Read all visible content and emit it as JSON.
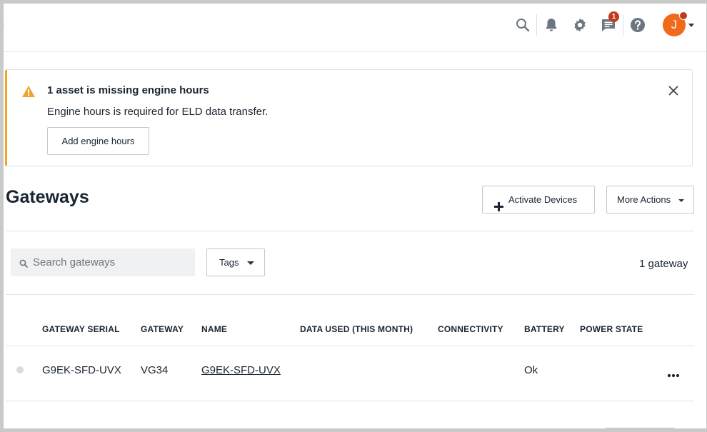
{
  "topbar": {
    "crumb_fragment": "t",
    "notifications_badge": "1",
    "avatar_initial": "J",
    "icons": [
      "search-icon",
      "bell-icon",
      "gear-icon",
      "chat-icon",
      "help-icon"
    ]
  },
  "alert": {
    "title": "1 asset is missing engine hours",
    "body": "Engine hours is required for ELD data transfer.",
    "button_label": "Add engine hours",
    "accent_color": "#f0a42c"
  },
  "page": {
    "title": "Gateways",
    "activate_label": "Activate Devices",
    "more_actions_label": "More Actions"
  },
  "toolbar": {
    "search_placeholder": "Search gateways",
    "tags_label": "Tags",
    "count_text": "1 gateway"
  },
  "table": {
    "columns": [
      "GATEWAY SERIAL",
      "GATEWAY",
      "NAME",
      "DATA USED (THIS MONTH)",
      "CONNECTIVITY",
      "BATTERY",
      "POWER STATE"
    ],
    "rows": [
      {
        "serial": "G9EK-SFD-UVX",
        "gateway": "VG34",
        "name": "G9EK-SFD-UVX",
        "data_used": "",
        "connectivity": "",
        "battery": "Ok",
        "power_state": ""
      }
    ]
  },
  "colors": {
    "avatar": "#f06a1c",
    "badge": "#c23a1d"
  }
}
